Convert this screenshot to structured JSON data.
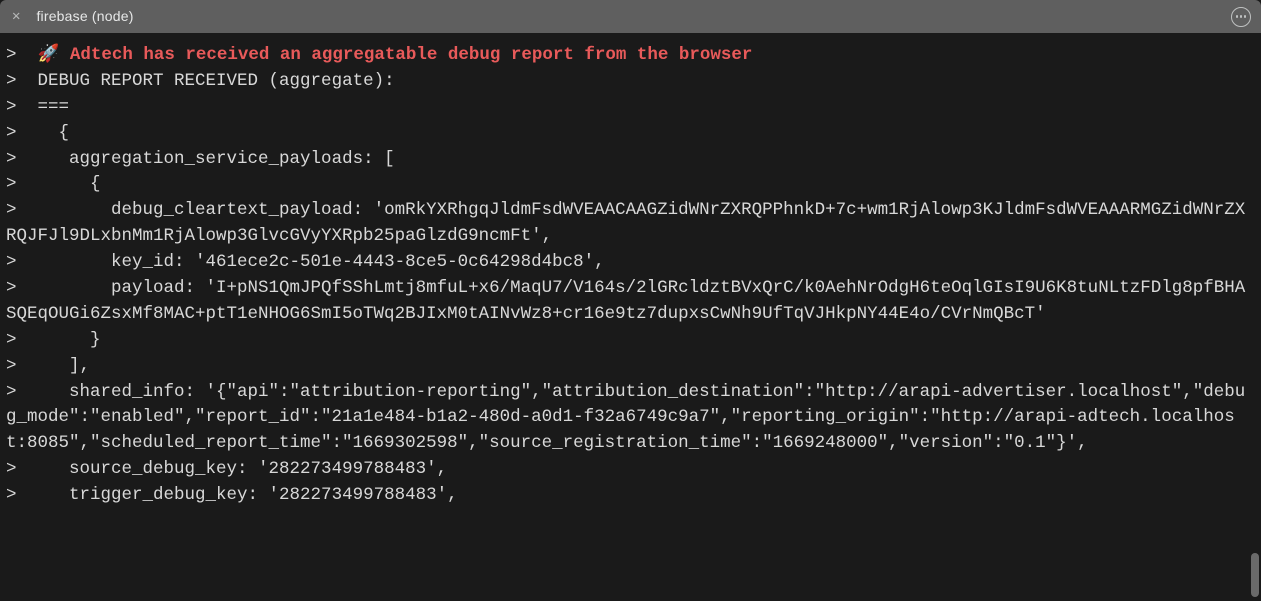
{
  "tab": {
    "title": "firebase (node)"
  },
  "terminal": {
    "lines": [
      {
        "prompt": ">  ",
        "segments": [
          {
            "cls": "rocket",
            "text": "🚀 "
          },
          {
            "cls": "highlight",
            "text": "Adtech has received an aggregatable debug report from the browser"
          }
        ]
      },
      {
        "prompt": ">  ",
        "segments": [
          {
            "cls": "",
            "text": "DEBUG REPORT RECEIVED (aggregate):"
          }
        ]
      },
      {
        "prompt": ">  ",
        "segments": [
          {
            "cls": "",
            "text": "==="
          }
        ]
      },
      {
        "prompt": ">  ",
        "segments": [
          {
            "cls": "",
            "text": "  {"
          }
        ]
      },
      {
        "prompt": ">  ",
        "segments": [
          {
            "cls": "",
            "text": "   aggregation_service_payloads: ["
          }
        ]
      },
      {
        "prompt": ">  ",
        "segments": [
          {
            "cls": "",
            "text": "     {"
          }
        ]
      },
      {
        "prompt": ">  ",
        "segments": [
          {
            "cls": "",
            "text": "       debug_cleartext_payload: 'omRkYXRhgqJldmFsdWVEAACAAGZidWNrZXRQPPhnkD+7c+wm1RjAlowp3KJldmFsdWVEAAARMGZidWNrZXRQJFJl9DLxbnMm1RjAlowp3GlvcGVyYXRpb25paGlzdG9ncmFt',"
          }
        ],
        "wrap": true
      },
      {
        "prompt": ">  ",
        "segments": [
          {
            "cls": "",
            "text": "       key_id: '461ece2c-501e-4443-8ce5-0c64298d4bc8',"
          }
        ]
      },
      {
        "prompt": ">  ",
        "segments": [
          {
            "cls": "",
            "text": "       payload: 'I+pNS1QmJPQfSShLmtj8mfuL+x6/MaqU7/V164s/2lGRcldztBVxQrC/k0AehNrOdgH6teOqlGIsI9U6K8tuNLtzFDlg8pfBHASQEqOUGi6ZsxMf8MAC+ptT1eNHOG6SmI5oTWq2BJIxM0tAINvWz8+cr16e9tz7dupxsCwNh9UfTqVJHkpNY44E4o/CVrNmQBcT'"
          }
        ],
        "wrap": true
      },
      {
        "prompt": ">  ",
        "segments": [
          {
            "cls": "",
            "text": "     }"
          }
        ]
      },
      {
        "prompt": ">  ",
        "segments": [
          {
            "cls": "",
            "text": "   ],"
          }
        ]
      },
      {
        "prompt": ">  ",
        "segments": [
          {
            "cls": "",
            "text": "   shared_info: '{\"api\":\"attribution-reporting\",\"attribution_destination\":\"http://arapi-advertiser.localhost\",\"debug_mode\":\"enabled\",\"report_id\":\"21a1e484-b1a2-480d-a0d1-f32a6749c9a7\",\"reporting_origin\":\"http://arapi-adtech.localhost:8085\",\"scheduled_report_time\":\"1669302598\",\"source_registration_time\":\"1669248000\",\"version\":\"0.1\"}',"
          }
        ],
        "wrap": true
      },
      {
        "prompt": ">  ",
        "segments": [
          {
            "cls": "",
            "text": "   source_debug_key: '282273499788483',"
          }
        ]
      },
      {
        "prompt": ">  ",
        "segments": [
          {
            "cls": "",
            "text": "   trigger_debug_key: '282273499788483',"
          }
        ]
      }
    ]
  }
}
